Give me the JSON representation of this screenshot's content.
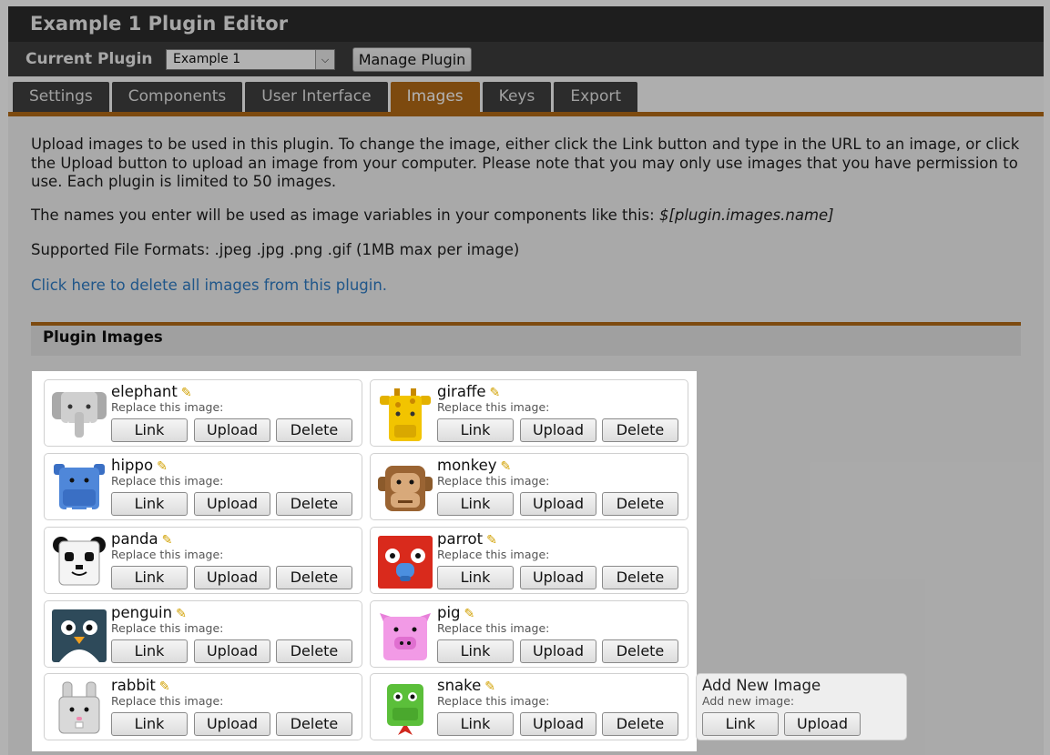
{
  "window": {
    "title": "Example 1 Plugin Editor"
  },
  "plugin_bar": {
    "label": "Current Plugin",
    "selected_plugin": "Example 1",
    "manage_button": "Manage Plugin"
  },
  "tabs": [
    {
      "label": "Settings",
      "active": false
    },
    {
      "label": "Components",
      "active": false
    },
    {
      "label": "User Interface",
      "active": false
    },
    {
      "label": "Images",
      "active": true
    },
    {
      "label": "Keys",
      "active": false
    },
    {
      "label": "Export",
      "active": false
    }
  ],
  "intro": {
    "p1": "Upload images to be used in this plugin. To change the image, either click the Link button and type in the URL to an image, or click the Upload button to upload an image from your computer. Please note that you may only use images that you have permission to use. Each plugin is limited to 50 images.",
    "p2_prefix": "The names you enter will be used as image variables in your components like this: ",
    "p2_code": "$[plugin.images.name]",
    "p3": "Supported File Formats: .jpeg .jpg .png .gif (1MB max per image)",
    "delete_link": "Click here to delete all images from this plugin."
  },
  "section": {
    "title": "Plugin Images"
  },
  "image_card_labels": {
    "replace": "Replace this image:",
    "link": "Link",
    "upload": "Upload",
    "delete": "Delete"
  },
  "images": [
    {
      "name": "elephant",
      "icon": "elephant-icon"
    },
    {
      "name": "giraffe",
      "icon": "giraffe-icon"
    },
    {
      "name": "hippo",
      "icon": "hippo-icon"
    },
    {
      "name": "monkey",
      "icon": "monkey-icon"
    },
    {
      "name": "panda",
      "icon": "panda-icon"
    },
    {
      "name": "parrot",
      "icon": "parrot-icon"
    },
    {
      "name": "penguin",
      "icon": "penguin-icon"
    },
    {
      "name": "pig",
      "icon": "pig-icon"
    },
    {
      "name": "rabbit",
      "icon": "rabbit-icon"
    },
    {
      "name": "snake",
      "icon": "snake-icon"
    }
  ],
  "add_new": {
    "title": "Add New Image",
    "sub": "Add new image:",
    "link": "Link",
    "upload": "Upload"
  },
  "colors": {
    "accent": "#b46a16",
    "link": "#2f7cc5",
    "header_dark": "#2c2c2c"
  }
}
